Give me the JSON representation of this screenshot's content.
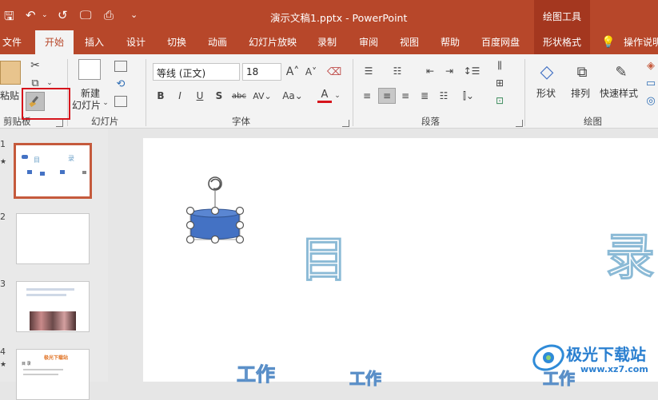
{
  "window": {
    "title": "演示文稿1.pptx  -  PowerPoint",
    "contextual_tab_group": "绘图工具"
  },
  "tabs": [
    {
      "label": "文件"
    },
    {
      "label": "开始"
    },
    {
      "label": "插入"
    },
    {
      "label": "设计"
    },
    {
      "label": "切换"
    },
    {
      "label": "动画"
    },
    {
      "label": "幻灯片放映"
    },
    {
      "label": "录制"
    },
    {
      "label": "审阅"
    },
    {
      "label": "视图"
    },
    {
      "label": "帮助"
    },
    {
      "label": "百度网盘"
    },
    {
      "label": "形状格式"
    },
    {
      "label": "操作说明"
    }
  ],
  "ribbon": {
    "clipboard": {
      "paste": "粘贴",
      "group": "剪贴板"
    },
    "slides": {
      "new_line1": "新建",
      "new_line2": "幻灯片",
      "group": "幻灯片"
    },
    "font": {
      "name": "等线 (正文)",
      "size": "18",
      "group": "字体"
    },
    "paragraph": {
      "group": "段落"
    },
    "drawing": {
      "shape": "形状",
      "arrange": "排列",
      "quick_styles": "快速样式",
      "group": "绘图"
    }
  },
  "slides": [
    {
      "number": "1"
    },
    {
      "number": "2"
    },
    {
      "number": "3"
    },
    {
      "number": "4"
    }
  ],
  "thumb1_text": {
    "mu": "目",
    "lu": "录"
  },
  "thumb4_text": {
    "heading": "极光下载站",
    "sub": "目  录"
  },
  "slide": {
    "text_mu": "目",
    "text_lu": "录",
    "text_work1": "工作",
    "text_work2": "工作",
    "text_work3": "工作"
  },
  "watermark": {
    "name": "极光下载站",
    "url": "www.xz7.com"
  },
  "colors": {
    "accent": "#b7472a",
    "shape_fill": "#4472c4",
    "outline_text": "#8bbad6",
    "highlight": "#d6141c"
  }
}
